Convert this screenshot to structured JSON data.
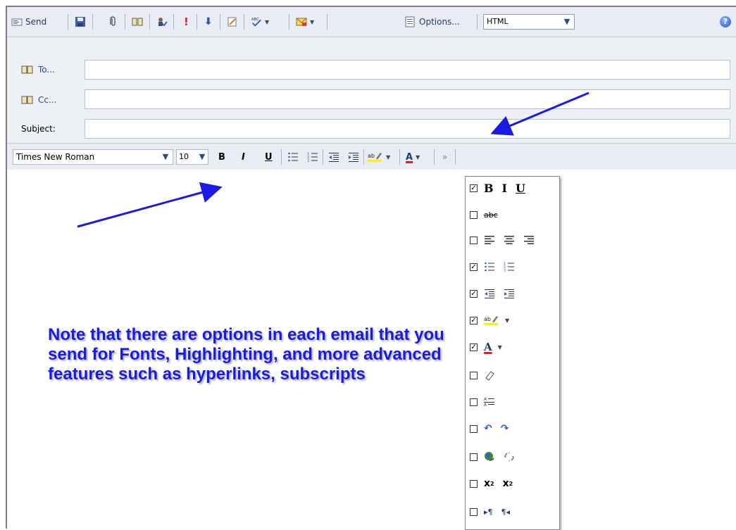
{
  "toolbar": {
    "send_label": "Send",
    "options_label": "Options...",
    "format_value": "HTML",
    "help_symbol": "?"
  },
  "header": {
    "to_label": "To...",
    "cc_label": "Cc...",
    "subject_label": "Subject:"
  },
  "format_bar": {
    "font_value": "Times New Roman",
    "size_value": "10",
    "bold": "B",
    "italic": "I",
    "underline": "U",
    "font_color": "A",
    "more": "»"
  },
  "panel": {
    "items": [
      {
        "checked": true,
        "icons": [
          "B",
          "I",
          "U"
        ]
      },
      {
        "checked": false,
        "icons": [
          "abc"
        ]
      },
      {
        "checked": false,
        "icons": [
          "align-left",
          "align-center",
          "align-right"
        ]
      },
      {
        "checked": true,
        "icons": [
          "bullets",
          "numbering"
        ]
      },
      {
        "checked": true,
        "icons": [
          "outdent",
          "indent"
        ]
      },
      {
        "checked": true,
        "icons": [
          "highlight"
        ]
      },
      {
        "checked": true,
        "icons": [
          "font-color"
        ]
      },
      {
        "checked": false,
        "icons": [
          "eraser"
        ]
      },
      {
        "checked": false,
        "icons": [
          "style"
        ]
      },
      {
        "checked": false,
        "icons": [
          "undo",
          "redo"
        ]
      },
      {
        "checked": false,
        "icons": [
          "link",
          "unlink"
        ]
      },
      {
        "checked": false,
        "icons": [
          "superscript",
          "subscript"
        ]
      },
      {
        "checked": false,
        "icons": [
          "ltr",
          "rtl"
        ]
      }
    ]
  },
  "note_text": "Note that there are options in each email that you send for Fonts, Highlighting, and more advanced features such as hyperlinks, subscripts",
  "colors": {
    "annotation_blue": "#1a1ae6",
    "toolbar_bg": "#e9edf3"
  }
}
